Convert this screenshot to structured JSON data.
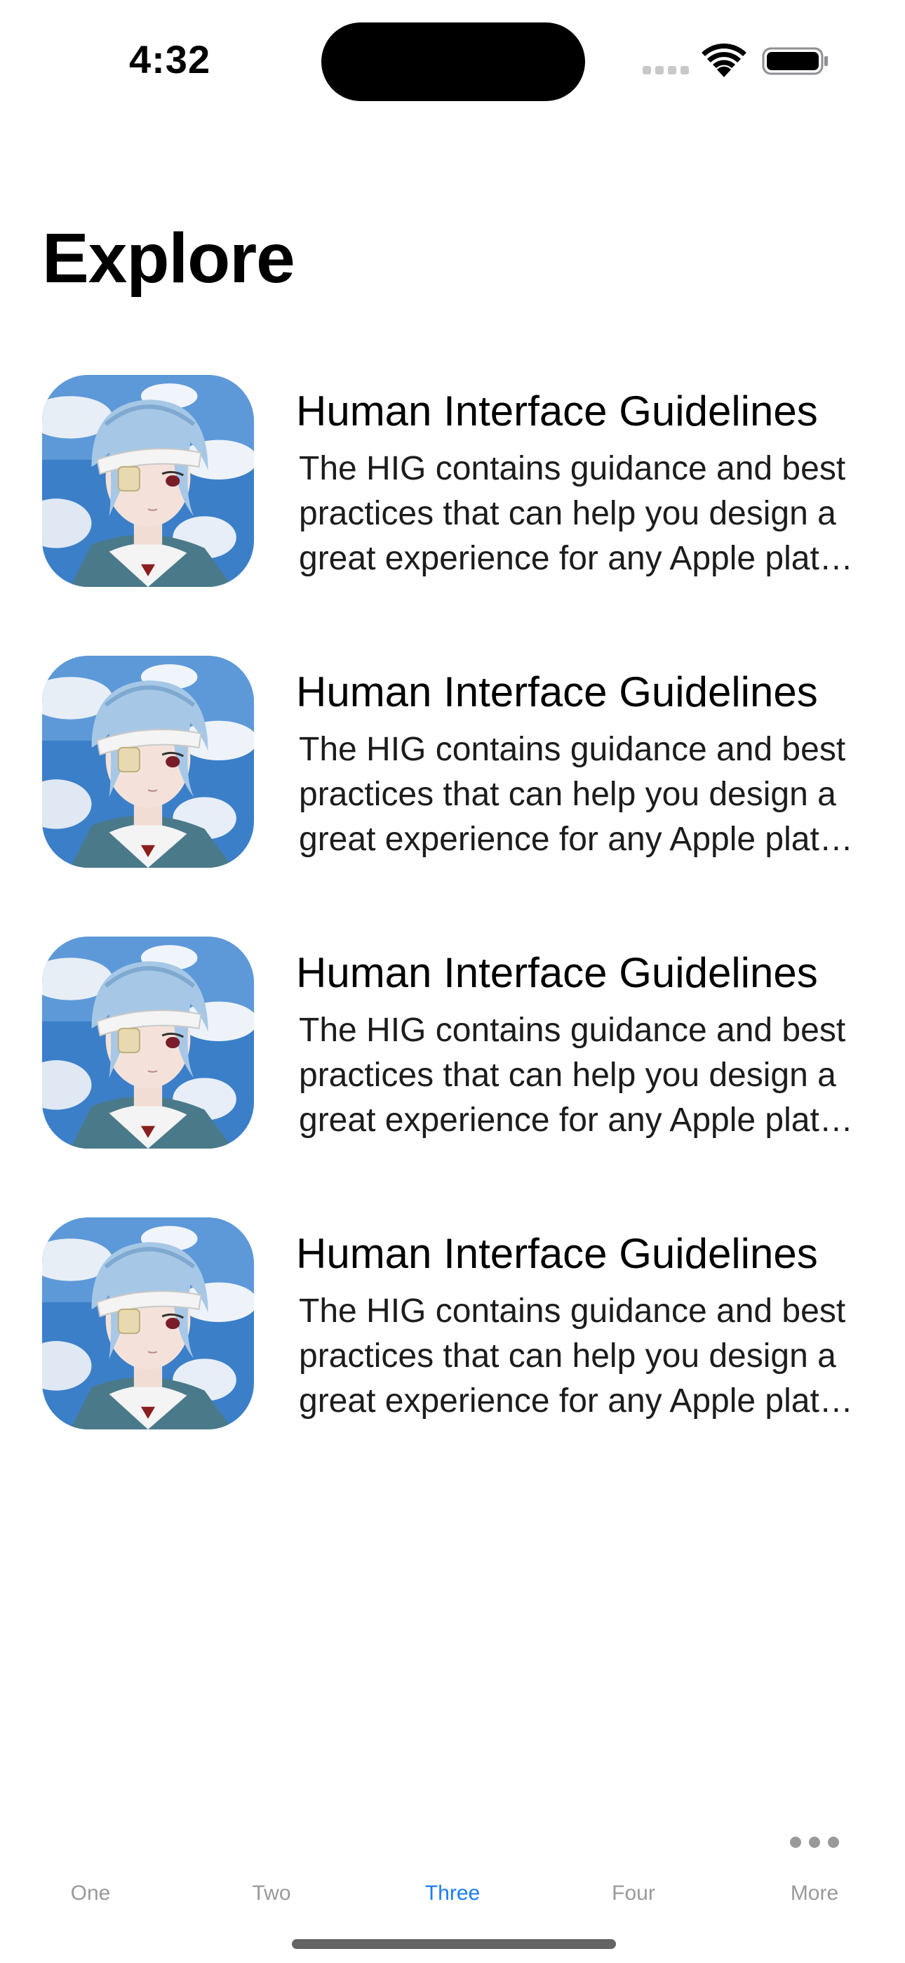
{
  "status_bar": {
    "time": "4:32"
  },
  "page": {
    "title": "Explore"
  },
  "list": {
    "items": [
      {
        "title": "Human Interface Guidelines",
        "desc_lines": [
          "The HIG contains guidance and best",
          "practices that can help you design a",
          "great experience for any Apple plat…"
        ],
        "thumbnail_icon": "anime-character-thumbnail"
      },
      {
        "title": "Human Interface Guidelines",
        "desc_lines": [
          "The HIG contains guidance and best",
          "practices that can help you design a",
          "great experience for any Apple plat…"
        ],
        "thumbnail_icon": "anime-character-thumbnail"
      },
      {
        "title": "Human Interface Guidelines",
        "desc_lines": [
          "The HIG contains guidance and best",
          "practices that can help you design a",
          "great experience for any Apple plat…"
        ],
        "thumbnail_icon": "anime-character-thumbnail"
      },
      {
        "title": "Human Interface Guidelines",
        "desc_lines": [
          "The HIG contains guidance and best",
          "practices that can help you design a",
          "great experience for any Apple plat…"
        ],
        "thumbnail_icon": "anime-character-thumbnail"
      }
    ]
  },
  "tab_bar": {
    "tabs": [
      {
        "label": "One"
      },
      {
        "label": "Two"
      },
      {
        "label": "Three",
        "selected": true
      },
      {
        "label": "Four"
      },
      {
        "label": "More",
        "icon": "more-icon"
      }
    ]
  },
  "colors": {
    "accent": "#1a7cf3",
    "inactive_tab": "#999999",
    "text": "#000000"
  }
}
